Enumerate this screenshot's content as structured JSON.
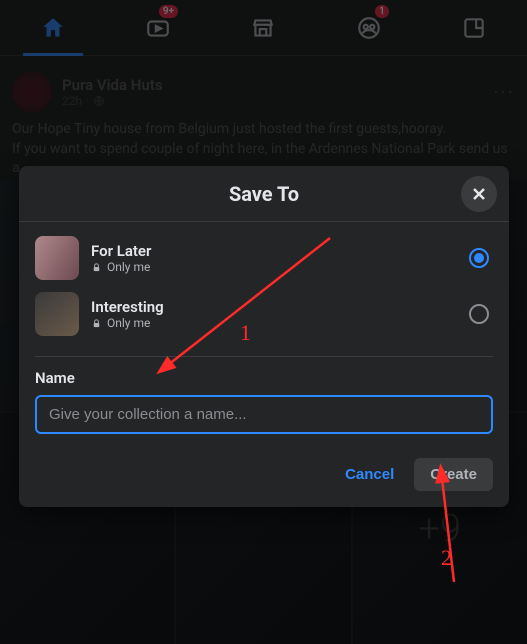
{
  "nav": {
    "video_badge": "9+",
    "group_badge": "1"
  },
  "post": {
    "author": "Pura Vida Huts",
    "time": "22h",
    "body_line1": "Our Hope Tiny house from Belgium just hosted the first guests,hooray.",
    "body_line2": "If you want to spend couple of night here, in the Ardennes National Park send us a",
    "more_images": "+9"
  },
  "modal": {
    "title": "Save To",
    "collections": [
      {
        "name": "For Later",
        "privacy": "Only me"
      },
      {
        "name": "Interesting",
        "privacy": "Only me"
      }
    ],
    "name_label": "Name",
    "name_placeholder": "Give your collection a name...",
    "cancel": "Cancel",
    "create": "Create"
  },
  "annotations": {
    "label1": "1",
    "label2": "2"
  }
}
